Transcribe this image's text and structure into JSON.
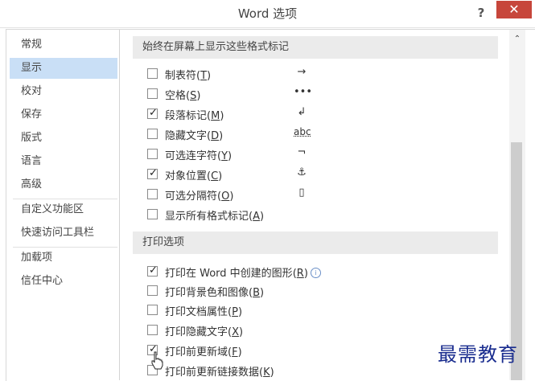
{
  "window": {
    "title": "Word 选项",
    "help_label": "?",
    "close_label": "✕"
  },
  "sidebar": {
    "items": [
      {
        "label": "常规",
        "selected": false
      },
      {
        "label": "显示",
        "selected": true
      },
      {
        "label": "校对",
        "selected": false
      },
      {
        "label": "保存",
        "selected": false
      },
      {
        "label": "版式",
        "selected": false
      },
      {
        "label": "语言",
        "selected": false
      },
      {
        "label": "高级",
        "selected": false
      },
      {
        "label": "自定义功能区",
        "selected": false
      },
      {
        "label": "快速访问工具栏",
        "selected": false
      },
      {
        "label": "加载项",
        "selected": false
      },
      {
        "label": "信任中心",
        "selected": false
      }
    ]
  },
  "formatting_marks": {
    "header": "始终在屏幕上显示这些格式标记",
    "options": [
      {
        "label": "制表符",
        "key": "T",
        "checked": false,
        "glyph": "→"
      },
      {
        "label": "空格",
        "key": "S",
        "checked": false,
        "glyph": "•••"
      },
      {
        "label": "段落标记",
        "key": "M",
        "checked": true,
        "glyph": "↲"
      },
      {
        "label": "隐藏文字",
        "key": "D",
        "checked": false,
        "glyph": "abc"
      },
      {
        "label": "可选连字符",
        "key": "Y",
        "checked": false,
        "glyph": "¬"
      },
      {
        "label": "对象位置",
        "key": "C",
        "checked": true,
        "glyph": "⚓"
      },
      {
        "label": "可选分隔符",
        "key": "O",
        "checked": false,
        "glyph": "▯"
      },
      {
        "label": "显示所有格式标记",
        "key": "A",
        "checked": false,
        "glyph": ""
      }
    ]
  },
  "print_options": {
    "header": "打印选项",
    "options": [
      {
        "label": "打印在 Word 中创建的图形",
        "key": "R",
        "checked": true,
        "info": "i"
      },
      {
        "label": "打印背景色和图像",
        "key": "B",
        "checked": false
      },
      {
        "label": "打印文档属性",
        "key": "P",
        "checked": false
      },
      {
        "label": "打印隐藏文字",
        "key": "X",
        "checked": false
      },
      {
        "label": "打印前更新域",
        "key": "F",
        "checked": true
      },
      {
        "label": "打印前更新链接数据",
        "key": "K",
        "checked": false
      }
    ]
  },
  "scrollbar": {
    "up_arrow": "⌃"
  },
  "watermark": {
    "text": "最需教育"
  },
  "colors": {
    "selected_nav": "#c9dff6",
    "section_header": "#ebebeb",
    "close_button": "#c7463b",
    "watermark": "#1a2d8f"
  }
}
